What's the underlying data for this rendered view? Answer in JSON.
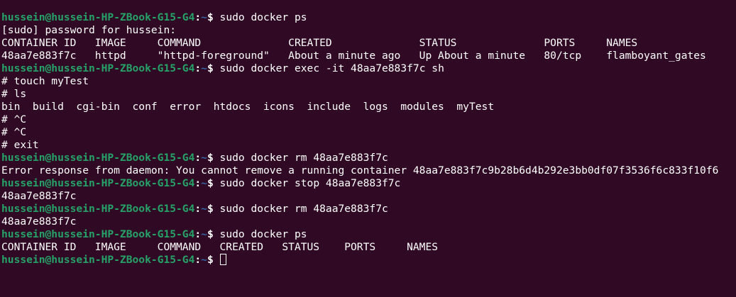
{
  "prompt": {
    "user_host": "hussein@hussein-HP-ZBook-G15-G4",
    "colon": ":",
    "path": "~",
    "symbol": "$ "
  },
  "lines": [
    {
      "type": "prompt",
      "command": "sudo docker ps"
    },
    {
      "type": "output",
      "text": "[sudo] password for hussein: "
    },
    {
      "type": "output",
      "text": "CONTAINER ID   IMAGE     COMMAND              CREATED              STATUS              PORTS     NAMES"
    },
    {
      "type": "output",
      "text": "48aa7e883f7c   httpd     \"httpd-foreground\"   About a minute ago   Up About a minute   80/tcp    flamboyant_gates"
    },
    {
      "type": "prompt",
      "command": "sudo docker exec -it 48aa7e883f7c sh"
    },
    {
      "type": "output",
      "text": "# touch myTest"
    },
    {
      "type": "output",
      "text": "# ls"
    },
    {
      "type": "output",
      "text": "bin  build  cgi-bin  conf  error  htdocs  icons  include  logs  modules  myTest"
    },
    {
      "type": "output",
      "text": "# ^C"
    },
    {
      "type": "output",
      "text": "# ^C"
    },
    {
      "type": "output",
      "text": "# exit"
    },
    {
      "type": "prompt",
      "command": "sudo docker rm 48aa7e883f7c"
    },
    {
      "type": "output",
      "text": "Error response from daemon: You cannot remove a running container 48aa7e883f7c9b28b6d4b292e3bb0df07f3536f6c833f10f6"
    },
    {
      "type": "prompt",
      "command": "sudo docker stop 48aa7e883f7c"
    },
    {
      "type": "output",
      "text": "48aa7e883f7c"
    },
    {
      "type": "prompt",
      "command": "sudo docker rm 48aa7e883f7c"
    },
    {
      "type": "output",
      "text": "48aa7e883f7c"
    },
    {
      "type": "prompt",
      "command": "sudo docker ps"
    },
    {
      "type": "output",
      "text": "CONTAINER ID   IMAGE     COMMAND   CREATED   STATUS    PORTS     NAMES"
    },
    {
      "type": "prompt_cursor",
      "command": ""
    }
  ],
  "colors": {
    "background": "#300a24",
    "user_host": "#26a269",
    "path": "#3465a4",
    "text": "#ffffff"
  }
}
